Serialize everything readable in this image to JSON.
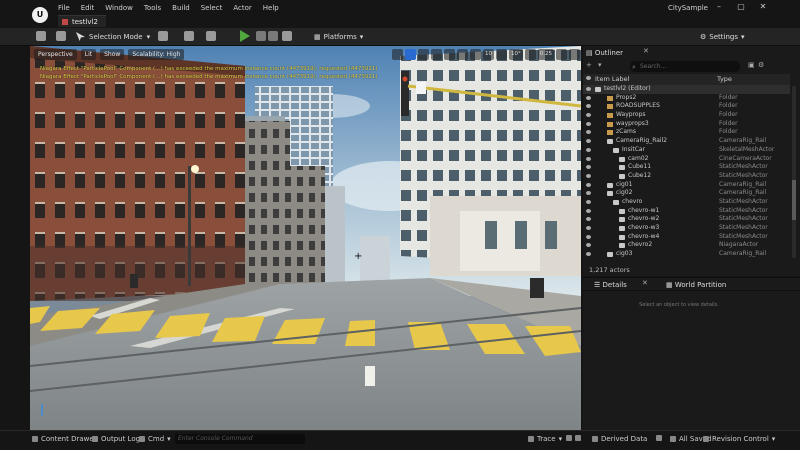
{
  "app": {
    "logo_text": "U",
    "menu": [
      "File",
      "Edit",
      "Window",
      "Tools",
      "Build",
      "Select",
      "Actor",
      "Help"
    ],
    "document_tab": "testlvl2",
    "project_name": "CitySample",
    "window_controls": [
      "–",
      "▢",
      "✕"
    ]
  },
  "toolbar": {
    "selection_mode": "Selection Mode",
    "platforms": "Platforms",
    "settings": "Settings"
  },
  "viewport": {
    "tools_left": [
      "Perspective",
      "Lit",
      "Show",
      "Scalability: High"
    ],
    "tools_right_values": [
      "10",
      "10°",
      "0.25"
    ],
    "warnings": [
      "Niagara Effect \"ParticlePool\" Component (…) has exceeded the maximum instance count (4473919), requested (4473921)",
      "Niagara Effect \"ParticlePool\" Component (…) has exceeded the maximum instance count (4473919), requested (4473921)"
    ],
    "crosshair": "+"
  },
  "outliner": {
    "tab": "Outliner",
    "close": "✕",
    "search_placeholder": "Search...",
    "columns": {
      "label": "Item Label",
      "type": "Type"
    },
    "rows": [
      {
        "label": "testlvl2 (Editor)",
        "type": "",
        "indent": 0,
        "icon": "world"
      },
      {
        "label": "Props2",
        "type": "Folder",
        "indent": 2,
        "icon": "folder"
      },
      {
        "label": "ROADSUPPLES",
        "type": "Folder",
        "indent": 2,
        "icon": "folder"
      },
      {
        "label": "Wayprops",
        "type": "Folder",
        "indent": 2,
        "icon": "folder"
      },
      {
        "label": "wayprops3",
        "type": "Folder",
        "indent": 2,
        "icon": "folder"
      },
      {
        "label": "zCams",
        "type": "Folder",
        "indent": 2,
        "icon": "folder"
      },
      {
        "label": "CameraRig_Rail2",
        "type": "CameraRig_Rail",
        "indent": 2,
        "icon": "actor"
      },
      {
        "label": "InsitCar",
        "type": "SkeletalMeshActor",
        "indent": 3,
        "icon": "actor"
      },
      {
        "label": "cam02",
        "type": "CineCameraActor",
        "indent": 4,
        "icon": "actor"
      },
      {
        "label": "Cube11",
        "type": "StaticMeshActor",
        "indent": 4,
        "icon": "actor"
      },
      {
        "label": "Cube12",
        "type": "StaticMeshActor",
        "indent": 4,
        "icon": "actor"
      },
      {
        "label": "cig01",
        "type": "CameraRig_Rail",
        "indent": 2,
        "icon": "actor"
      },
      {
        "label": "cig02",
        "type": "CameraRig_Rail",
        "indent": 2,
        "icon": "actor"
      },
      {
        "label": "chevro",
        "type": "StaticMeshActor",
        "indent": 3,
        "icon": "actor"
      },
      {
        "label": "chevro-w1",
        "type": "StaticMeshActor",
        "indent": 4,
        "icon": "actor"
      },
      {
        "label": "chevro-w2",
        "type": "StaticMeshActor",
        "indent": 4,
        "icon": "actor"
      },
      {
        "label": "chevro-w3",
        "type": "StaticMeshActor",
        "indent": 4,
        "icon": "actor"
      },
      {
        "label": "chevro-w4",
        "type": "StaticMeshActor",
        "indent": 4,
        "icon": "actor"
      },
      {
        "label": "chevro2",
        "type": "NiagaraActor",
        "indent": 4,
        "icon": "actor"
      },
      {
        "label": "cig03",
        "type": "CameraRig_Rail",
        "indent": 2,
        "icon": "actor"
      }
    ],
    "actor_count": "1,217 actors"
  },
  "details": {
    "tab": "Details",
    "close": "✕",
    "world_partition_tab": "World Partition",
    "hint": "Select an object to view details."
  },
  "statusbar": {
    "content_drawer": "Content Drawer",
    "output_log": "Output Log",
    "cmd": "Cmd",
    "console_placeholder": "Enter Console Command",
    "trace": "Trace",
    "derived_data": "Derived Data",
    "all_saved": "All Saved",
    "revision_control": "Revision Control"
  },
  "colors": {
    "accent_blue": "#2a6bd2",
    "play_green": "#4fa83d",
    "warning_yellow": "#e2d64a",
    "folder": "#c99a4b"
  }
}
